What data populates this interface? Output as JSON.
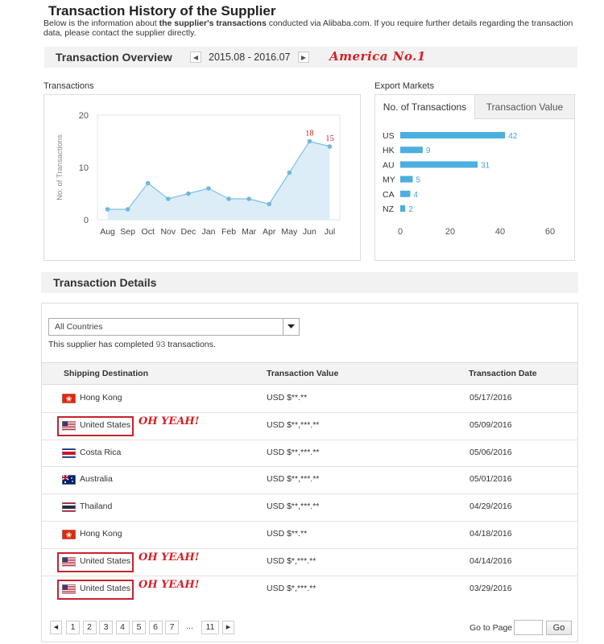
{
  "page": {
    "title": "Transaction History of the Supplier",
    "intro_pre": "Below is the information about ",
    "intro_bold": "the supplier's transactions",
    "intro_post": " conducted via Alibaba.com. If you require further details regarding the transaction data, please contact the supplier directly."
  },
  "overview": {
    "title": "Transaction Overview",
    "date_range": "2015.08 - 2016.07",
    "prev_icon": "triangle-left-icon",
    "next_icon": "triangle-right-icon",
    "annotation": "America No.1",
    "annotation_color": "#d61f26"
  },
  "transactions_panel": {
    "label": "Transactions"
  },
  "export_panel": {
    "label": "Export Markets",
    "tabs": [
      "No. of Transactions",
      "Transaction Value"
    ]
  },
  "chart_data": [
    {
      "type": "area",
      "ylabel": "No. of Transactions",
      "categories": [
        "Aug",
        "Sep",
        "Oct",
        "Nov",
        "Dec",
        "Jan",
        "Feb",
        "Mar",
        "Apr",
        "May",
        "Jun",
        "Jul"
      ],
      "values": [
        2,
        2,
        7,
        4,
        5,
        6,
        4,
        4,
        3,
        9,
        15,
        14
      ],
      "yticks": [
        0,
        10,
        20
      ],
      "ylim": [
        0,
        20
      ],
      "data_labels": [
        {
          "index": 10,
          "text": "18"
        },
        {
          "index": 11,
          "text": "15"
        }
      ],
      "line_color": "#7fc1e3",
      "fill_color": "#dcedf7",
      "grid": false
    },
    {
      "type": "bar",
      "orientation": "horizontal",
      "categories": [
        "US",
        "HK",
        "AU",
        "MY",
        "CA",
        "NZ"
      ],
      "values": [
        42,
        9,
        31,
        5,
        4,
        2
      ],
      "xticks": [
        0,
        20,
        40,
        60
      ],
      "xlim": [
        0,
        60
      ],
      "bar_color": "#4bafdf"
    }
  ],
  "details": {
    "title": "Transaction Details",
    "filter_value": "All Countries",
    "completed_pre": "This supplier has completed ",
    "completed_count": "93",
    "completed_post": " transactions.",
    "headers": [
      "Shipping Destination",
      "Transaction Value",
      "Transaction Date"
    ],
    "rows": [
      {
        "country": "Hong Kong",
        "value": "USD $**.**",
        "date": "05/17/2016",
        "flag": "hk"
      },
      {
        "country": "United States",
        "value": "USD $**,***.**",
        "date": "05/09/2016",
        "flag": "us"
      },
      {
        "country": "Costa Rica",
        "value": "USD $**,***.**",
        "date": "05/06/2016",
        "flag": "cr"
      },
      {
        "country": "Australia",
        "value": "USD $**,***.**",
        "date": "05/01/2016",
        "flag": "au"
      },
      {
        "country": "Thailand",
        "value": "USD $**,***.**",
        "date": "04/29/2016",
        "flag": "th"
      },
      {
        "country": "Hong Kong",
        "value": "USD $**.**",
        "date": "04/18/2016",
        "flag": "hk"
      },
      {
        "country": "United States",
        "value": "USD $*,***.**",
        "date": "04/14/2016",
        "flag": "us"
      },
      {
        "country": "United States",
        "value": "USD $*,***.**",
        "date": "03/29/2016",
        "flag": "us"
      }
    ],
    "oh_yeah": "OH YEAH!"
  },
  "pagination": {
    "pages": [
      "1",
      "2",
      "3",
      "4",
      "5",
      "6",
      "7"
    ],
    "ellipsis": "...",
    "last": "11",
    "goto_label": "Go to Page",
    "go_label": "Go"
  }
}
